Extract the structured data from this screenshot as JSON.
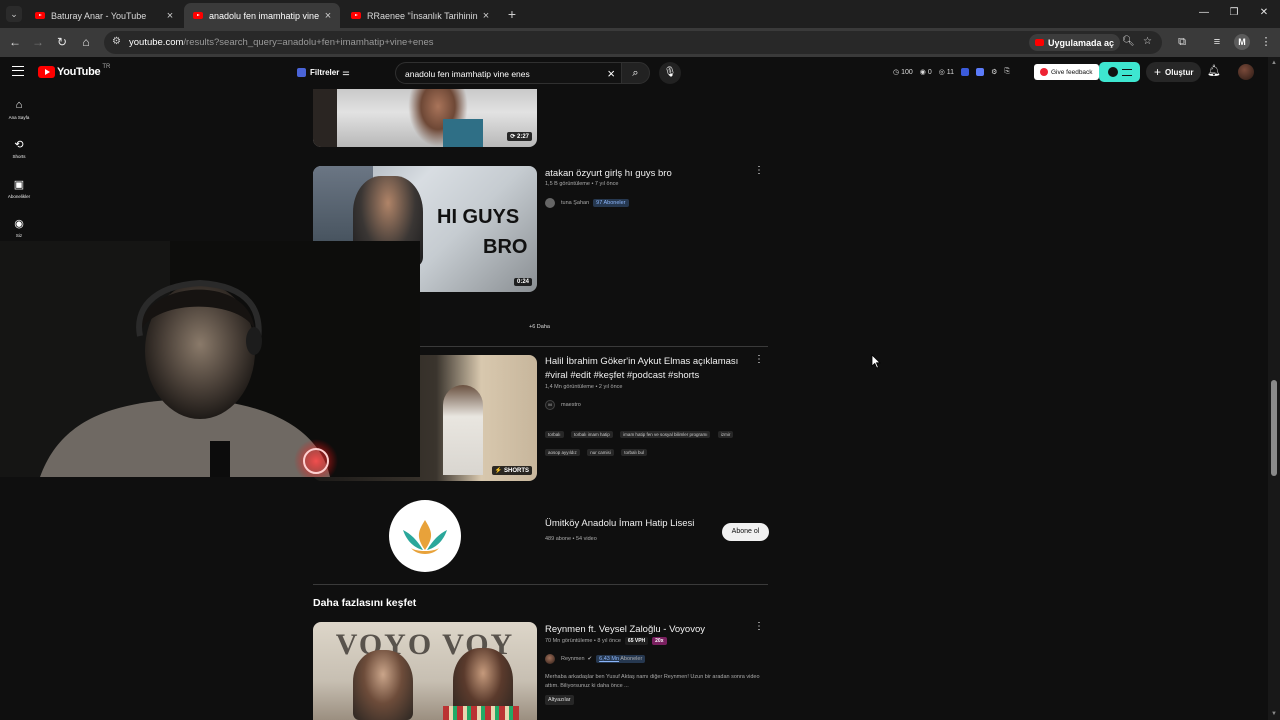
{
  "browser": {
    "tabs": [
      {
        "title": "Baturay Anar - YouTube",
        "active": false
      },
      {
        "title": "anadolu fen imamhatip vine en",
        "active": true
      },
      {
        "title": "RRaenee \"İnsanlık Tarihinin En",
        "active": false
      }
    ],
    "url_host": "youtube.com",
    "url_path": "/results?search_query=anadolu+fen+imamhatip+vine+enes",
    "open_in_app": "Uygulamada aç",
    "profile_initial": "M"
  },
  "masthead": {
    "logo_text": "YouTube",
    "country_code": "TR",
    "filters_label": "Filtreler",
    "search_query": "anadolu fen imamhatip vine enes",
    "stats": [
      "100",
      "0",
      "11"
    ],
    "feedback_label": "Give feedback",
    "create_label": "Oluştur"
  },
  "guide": [
    {
      "label": "Ana Sayfa",
      "icon": "home-icon"
    },
    {
      "label": "Shorts",
      "icon": "shorts-icon"
    },
    {
      "label": "Abonelikler",
      "icon": "subscriptions-icon"
    },
    {
      "label": "Siz",
      "icon": "you-icon"
    }
  ],
  "results": {
    "top_video": {
      "duration": "2:27"
    },
    "video1": {
      "title": "atakan özyurt girlş hı guys bro",
      "meta": "1,5 B görüntüleme • 7 yıl önce",
      "channel": "tuna Şahan",
      "subs_badge": "97 Aboneler",
      "thumb_text_1": "HI GUYS",
      "thumb_text_2": "BRO",
      "duration": "0:24"
    },
    "more_label": "+6 Daha",
    "short": {
      "title": "Halil İbrahim Göker'in Aykut Elmas açıklaması #viral #edit #keşfet #podcast #shorts",
      "meta": "1,4 Mn görüntüleme • 2 yıl önce",
      "channel": "maestro",
      "tags": [
        "torbalı",
        "torbalı imam hatip",
        "imam hatip fen ve sosyal bilimler programı",
        "izmir",
        "aosop ayyıldız",
        "nur camisi",
        "torbalı bul"
      ],
      "badge": "SHORTS"
    },
    "channel_card": {
      "name": "Ümitköy Anadolu İmam Hatip Lisesi",
      "meta": "489 abone • 54 video",
      "subscribe_label": "Abone ol"
    },
    "section_title": "Daha fazlasını keşfet",
    "video2": {
      "title": "Reynmen ft. Veysel Zaloğlu - Voyovoy",
      "meta": "70 Mn görüntüleme • 8 yıl önce",
      "vph": "65 VPH",
      "mult": "20x",
      "channel": "Reynmen",
      "subs_badge_num": "6,43 Mn",
      "subs_badge_label": "Aboneler",
      "description": "Merhaba arkadaşlar ben Yusuf Aktaş namı diğer Reynmen! Uzun bir aradan sonra video attım. Biliyorsunuz ki daha önce ...",
      "chip": "Altyazılar",
      "thumb_text": "VOYO VOY"
    }
  },
  "colors": {
    "bg": "#0f0f0f",
    "accent_red": "#ff0000",
    "cyan": "#3ee6d0",
    "badge_blue": "#8ab4f8"
  }
}
